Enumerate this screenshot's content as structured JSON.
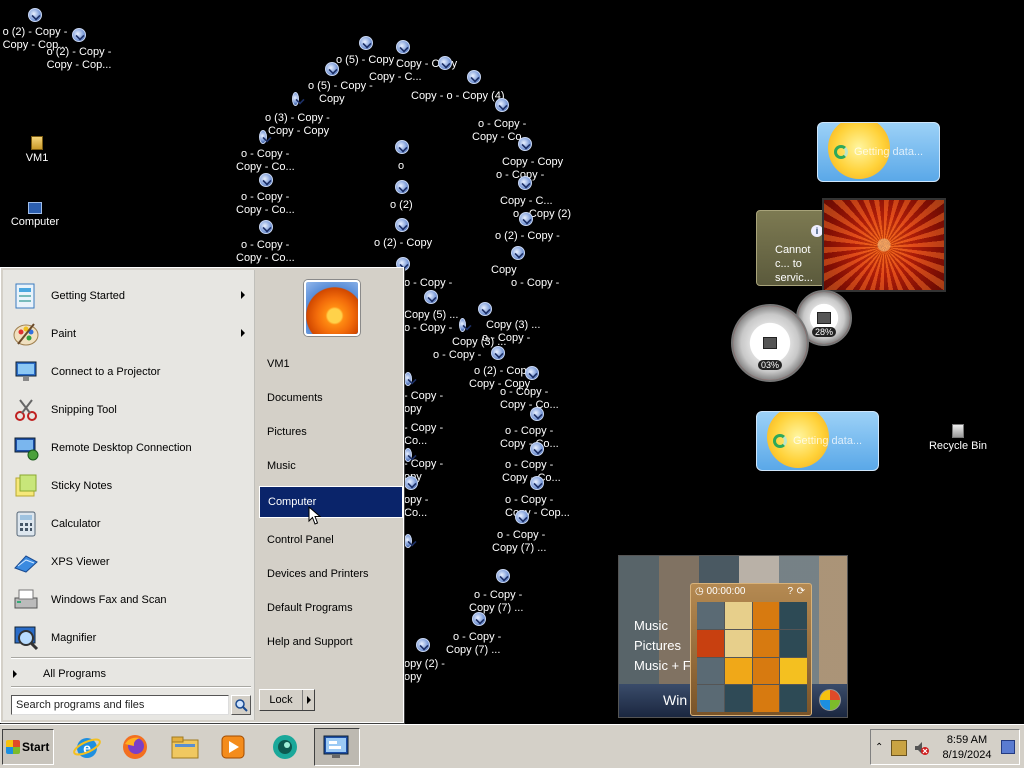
{
  "desktop": {
    "icons": [
      {
        "name": "VM1"
      },
      {
        "name": "Computer"
      },
      {
        "name": "Recycle Bin"
      }
    ],
    "copy_labels": [
      "o (2) - Copy -",
      "Copy - Cop...",
      "o (2) - Copy -",
      "Copy - Cop...",
      "o (5) - Copy -",
      "Copy - C...",
      "Copy - Copy",
      "o (5) - Copy -",
      "Copy",
      "Copy - o - Copy (4)",
      "o (3) - Copy -",
      "Copy - Copy",
      "o - Copy -",
      "Copy - Co...",
      "o - Copy -",
      "Copy - Co...",
      "o - Copy -",
      "Copy - Co...",
      "o",
      "o (2)",
      "o (2) - Copy",
      "o - Copy -",
      "Copy - Co...",
      "o - Copy -",
      "Copy - Copy",
      "o - Copy -",
      "Copy - C...",
      "o - Copy (2)",
      "o (2) - Copy -",
      "Copy",
      "o - Copy -",
      "Copy (5) ...",
      "o - Copy -",
      "Copy (3) ...",
      "o - Copy -",
      "Copy (3) ...",
      "o - Copy -",
      "Copy (4)",
      "o (2) - Copy -",
      "Copy - Copy",
      "o - Copy -",
      "Copy - Co...",
      "o - Copy -",
      "Copy - Co...",
      "o - Copy -",
      "Copy - Co...",
      "o - Copy -",
      "Copy - Cop...",
      "o - Copy -",
      "Copy (7) ...",
      "o - Copy -",
      "Copy (7) ...",
      "o - Copy -",
      "Copy (7) ...",
      "o - Copy -",
      "opy (8) ...",
      "opy (2) -",
      "opy",
      "- Copy -",
      "opy",
      "- Copy -",
      "Co...",
      "- Copy -",
      "opy",
      "opy -",
      "Co..."
    ]
  },
  "gadgets": {
    "weather1_text": "Getting data...",
    "weather2_text": "Getting data...",
    "currency_text": "Cannot c... to servic...",
    "cpu_percent": "03%",
    "mem_percent": "28%",
    "media_items": [
      "Music",
      "Pictures",
      "Music + F..."
    ],
    "media_bar_text": "Win",
    "puzzle_timer": "00:00:00"
  },
  "start_menu": {
    "left_items": [
      {
        "label": "Getting Started",
        "has_submenu": true
      },
      {
        "label": "Paint",
        "has_submenu": true
      },
      {
        "label": "Connect to a Projector",
        "has_submenu": false
      },
      {
        "label": "Snipping Tool",
        "has_submenu": false
      },
      {
        "label": "Remote Desktop Connection",
        "has_submenu": false
      },
      {
        "label": "Sticky Notes",
        "has_submenu": false
      },
      {
        "label": "Calculator",
        "has_submenu": false
      },
      {
        "label": "XPS Viewer",
        "has_submenu": false
      },
      {
        "label": "Windows Fax and Scan",
        "has_submenu": false
      },
      {
        "label": "Magnifier",
        "has_submenu": false
      }
    ],
    "all_programs": "All Programs",
    "search_placeholder": "Search programs and files",
    "right_items": [
      {
        "label": "VM1"
      },
      {
        "label": "Documents"
      },
      {
        "label": "Pictures"
      },
      {
        "label": "Music"
      },
      {
        "label": "Computer",
        "selected": true
      },
      {
        "label": "Control Panel"
      },
      {
        "label": "Devices and Printers"
      },
      {
        "label": "Default Programs"
      },
      {
        "label": "Help and Support"
      }
    ],
    "lock_label": "Lock"
  },
  "taskbar": {
    "start_label": "Start",
    "apps": [
      "internet-explorer",
      "firefox",
      "file-explorer",
      "media-player",
      "chrome-like",
      "remote-desktop"
    ],
    "clock_time": "8:59 AM",
    "clock_date": "8/19/2024"
  }
}
